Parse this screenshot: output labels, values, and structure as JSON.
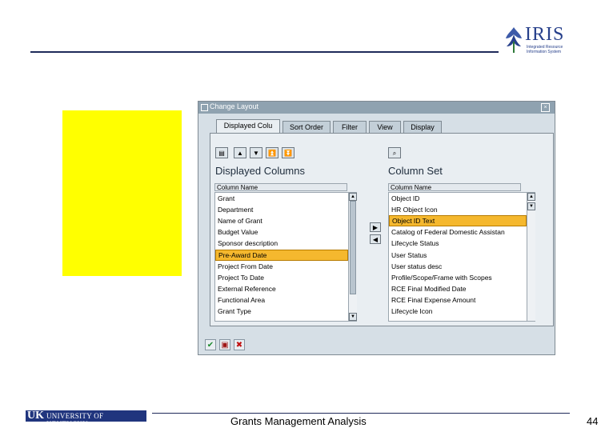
{
  "logo": {
    "text": "IRIS",
    "subtitle": "Integrated Resource Information System"
  },
  "dialog": {
    "title": "Change Layout",
    "tabs": [
      {
        "label": "Displayed Colu"
      },
      {
        "label": "Sort Order"
      },
      {
        "label": "Filter"
      },
      {
        "label": "View"
      },
      {
        "label": "Display"
      }
    ],
    "left_pane": {
      "title": "Displayed Columns",
      "column_header": "Column Name",
      "rows": [
        "Grant",
        "Department",
        "Name of Grant",
        "Budget Value",
        "Sponsor description",
        "Pre-Award Date",
        "Project From Date",
        "Project To Date",
        "External Reference",
        "Functional Area",
        "Grant Type"
      ],
      "selected": "Pre-Award Date"
    },
    "right_pane": {
      "title": "Column Set",
      "column_header": "Column Name",
      "rows": [
        "Object ID",
        "HR Object Icon",
        "Object ID Text",
        "Catalog of Federal Domestic Assistan",
        "Lifecycle Status",
        "User Status",
        "User status desc",
        "Profile/Scope/Frame with Scopes",
        "RCE Final Modified Date",
        "RCE Final Expense Amount",
        "Lifecycle Icon"
      ],
      "selected": "Object ID Text"
    }
  },
  "footer": {
    "university": "UNIVERSITY OF KENTUCKY",
    "uk": "UK",
    "title": "Grants Management Analysis",
    "page": "44"
  }
}
